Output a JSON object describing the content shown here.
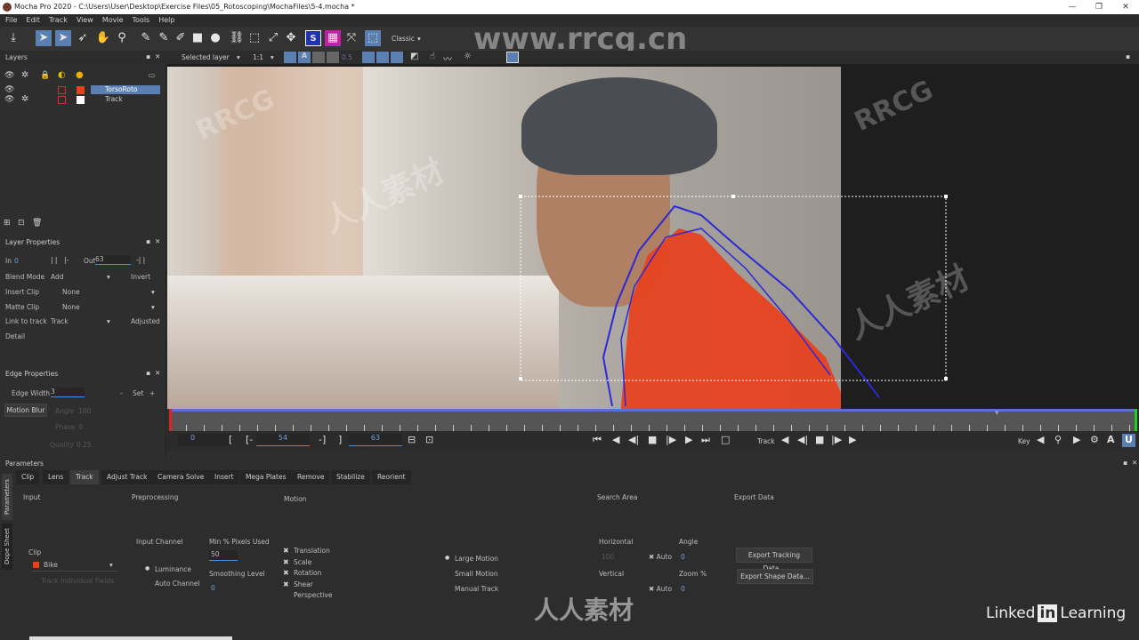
{
  "window": {
    "title": "Mocha Pro 2020 - C:\\Users\\User\\Desktop\\Exercise Files\\05_Rotoscoping\\MochaFiles\\5-4.mocha *"
  },
  "menu": [
    "File",
    "Edit",
    "Track",
    "View",
    "Movie",
    "Tools",
    "Help"
  ],
  "toolbar": {
    "workspace": "Classic",
    "s_icon": "S"
  },
  "viewer_toolbar": {
    "layer_select": "Selected layer",
    "zoom": "1:1",
    "opacity": "0.5"
  },
  "layers": {
    "title": "Layers",
    "items": [
      {
        "name": "TorsoRoto",
        "color": "#e8401c",
        "selected": true
      },
      {
        "name": "Track",
        "color": "#ffffff",
        "selected": false
      }
    ]
  },
  "layer_properties": {
    "title": "Layer Properties",
    "in_label": "In",
    "in_value": "0",
    "out_label": "Out",
    "out_value": "63",
    "blend_mode_label": "Blend Mode",
    "blend_mode": "Add",
    "invert": "Invert",
    "insert_clip_label": "Insert Clip",
    "insert_clip": "None",
    "matte_clip_label": "Matte Clip",
    "matte_clip": "None",
    "link_label": "Link to track",
    "link": "Track",
    "adjusted": "Adjusted",
    "detail": "Detail"
  },
  "edge_properties": {
    "title": "Edge Properties",
    "edge_width_label": "Edge Width",
    "edge_width": "3",
    "minus": "-",
    "set": "Set",
    "plus": "+",
    "motion_blur": "Motion Blur",
    "angle_label": "Angle",
    "angle": "180",
    "phase_label": "Phase",
    "phase": "0",
    "quality_label": "Quality",
    "quality": "0.25"
  },
  "timeline": {
    "start": "0",
    "current": "54",
    "end": "63",
    "track_label": "Track",
    "key_label": "Key"
  },
  "parameters": {
    "title": "Parameters",
    "side_tabs": [
      "Parameters",
      "Dope Sheet"
    ],
    "tabs": [
      "Clip",
      "Lens",
      "Track",
      "Adjust Track",
      "Camera Solve",
      "Insert",
      "Mega Plates",
      "Remove",
      "Stabilize",
      "Reorient"
    ],
    "active_tab": "Track",
    "sections": {
      "input": "Input",
      "preprocessing": "Preprocessing",
      "motion": "Motion",
      "search_area": "Search Area",
      "export_data": "Export Data"
    },
    "clip_label": "Clip",
    "clip": "Bike",
    "clip_hint": "Track Individual Fields",
    "input_channel_label": "Input Channel",
    "luminance": "Luminance",
    "auto_channel": "Auto Channel",
    "min_pixels_label": "Min % Pixels Used",
    "min_pixels": "50",
    "smoothing_label": "Smoothing Level",
    "smoothing": "0",
    "motion_options": [
      {
        "label": "Translation",
        "checked": true
      },
      {
        "label": "Scale",
        "checked": true
      },
      {
        "label": "Rotation",
        "checked": true
      },
      {
        "label": "Shear",
        "checked": true
      },
      {
        "label": "Perspective",
        "checked": false
      }
    ],
    "track_modes": [
      {
        "label": "Large Motion",
        "selected": true
      },
      {
        "label": "Small Motion",
        "selected": false
      },
      {
        "label": "Manual Track",
        "selected": false
      }
    ],
    "horizontal_label": "Horizontal",
    "horizontal": "100",
    "vertical_label": "Vertical",
    "auto": "Auto",
    "angle_label": "Angle",
    "angle": "0",
    "zoom_label": "Zoom %",
    "zoom": "0",
    "export_tracking": "Export Tracking Data...",
    "export_shape": "Export Shape Data..."
  },
  "watermarks": {
    "site": "www.rrcg.cn",
    "rrcg": "RRCG",
    "cn": "人人素材",
    "linkedin": "Linked",
    "learning": "Learning"
  }
}
